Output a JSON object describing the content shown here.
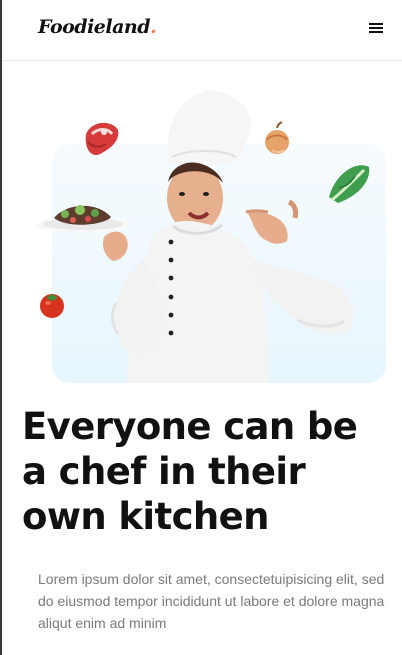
{
  "header": {
    "logo_text": "Foodieland",
    "logo_dot": ".",
    "menu_icon": "hamburger-menu-icon"
  },
  "hero": {
    "image": "chef-holding-salad-plate",
    "decor_icons": [
      "steak-icon",
      "onion-icon",
      "lettuce-icon",
      "tomato-icon"
    ]
  },
  "main": {
    "headline": "Everyone can be a chef in their own kitchen",
    "description": "Lorem ipsum dolor sit amet, consectetuipisicing elit, sed do eiusmod tempor incididunt ut labore et dolore magna aliqut enim ad minim"
  },
  "colors": {
    "accent": "#ff7a45",
    "hero_bg": "#e7f6fd",
    "text_primary": "#111111",
    "text_muted": "#7a7a7a"
  }
}
